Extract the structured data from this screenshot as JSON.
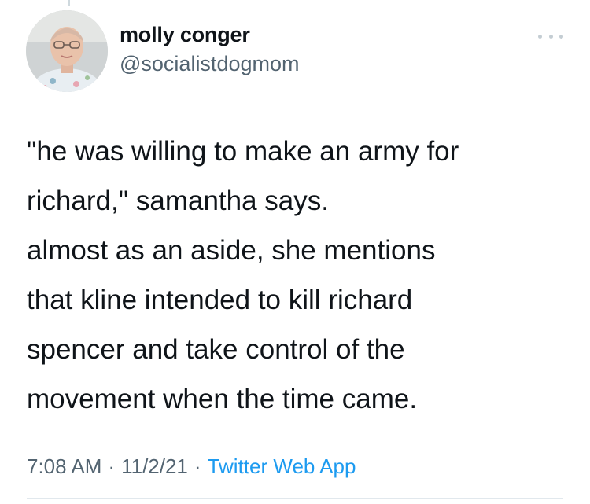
{
  "author": {
    "display_name": "molly conger",
    "handle": "@socialistdogmom"
  },
  "tweet": {
    "text": "\"he was willing to make an army for\nrichard,\" samantha says.\nalmost as an aside, she mentions\nthat kline intended to kill richard\nspencer and take control of the\nmovement when the time came."
  },
  "meta": {
    "time": "7:08 AM",
    "separator": "·",
    "date": "11/2/21",
    "source": "Twitter Web App"
  },
  "icons": {
    "more": "more-horizontal-icon"
  },
  "colors": {
    "text": "#0f1419",
    "secondary": "#536471",
    "link": "#1d9bf0",
    "divider": "#e1e8ed"
  }
}
